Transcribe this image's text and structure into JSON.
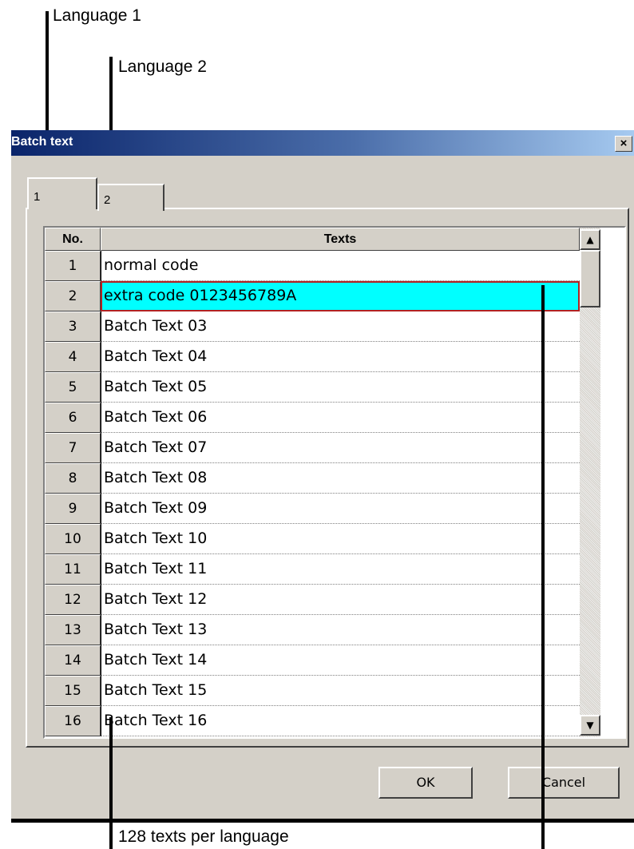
{
  "annotations": {
    "language1": "Language 1",
    "language2": "Language 2",
    "texts_per_language": "128 texts per language"
  },
  "dialog": {
    "title": "Batch text",
    "close_label": "×"
  },
  "tabs": [
    {
      "label": "1",
      "active": true
    },
    {
      "label": "2",
      "active": false
    }
  ],
  "grid": {
    "columns": [
      "No.",
      "Texts"
    ],
    "rows": [
      {
        "no": "1",
        "text": "normal code"
      },
      {
        "no": "2",
        "text": "extra code 0123456789A"
      },
      {
        "no": "3",
        "text": "Batch Text 03"
      },
      {
        "no": "4",
        "text": "Batch Text 04"
      },
      {
        "no": "5",
        "text": "Batch Text 05"
      },
      {
        "no": "6",
        "text": "Batch Text 06"
      },
      {
        "no": "7",
        "text": "Batch Text 07"
      },
      {
        "no": "8",
        "text": "Batch Text 08"
      },
      {
        "no": "9",
        "text": "Batch Text 09"
      },
      {
        "no": "10",
        "text": "Batch Text 10"
      },
      {
        "no": "11",
        "text": "Batch Text 11"
      },
      {
        "no": "12",
        "text": "Batch Text 12"
      },
      {
        "no": "13",
        "text": "Batch Text 13"
      },
      {
        "no": "14",
        "text": "Batch Text 14"
      },
      {
        "no": "15",
        "text": "Batch Text 15"
      },
      {
        "no": "16",
        "text": "Batch Text 16"
      }
    ],
    "selected_row": 2,
    "selection_color": "#00ffff"
  },
  "buttons": {
    "ok": "OK",
    "cancel": "Cancel"
  },
  "colors": {
    "titlebar_start": "#0a246a",
    "titlebar_end": "#a6caf0",
    "window_face": "#d4d0c8"
  }
}
